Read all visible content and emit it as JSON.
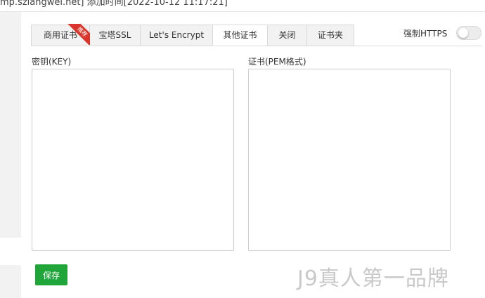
{
  "header": {
    "clipped_text": "mp.szlangwei.net]   添加时间[2022-10-12 11:17:21]"
  },
  "tabs": [
    {
      "label": "商用证书",
      "active": false,
      "badge": "推荐"
    },
    {
      "label": "宝塔SSL",
      "active": false
    },
    {
      "label": "Let's Encrypt",
      "active": false
    },
    {
      "label": "其他证书",
      "active": true
    },
    {
      "label": "关闭",
      "active": false
    },
    {
      "label": "证书夹",
      "active": false
    }
  ],
  "force_https": {
    "label": "强制HTTPS",
    "enabled": false
  },
  "key_field": {
    "label": "密钥(KEY)",
    "value": ""
  },
  "cert_field": {
    "label": "证书(PEM格式)",
    "value": ""
  },
  "save_button": {
    "label": "保存"
  },
  "watermark": {
    "text": "J9真人第一品牌"
  },
  "colors": {
    "primary_green": "#20a53a",
    "badge_red": "#d9352a",
    "border": "#d9d9d9"
  }
}
